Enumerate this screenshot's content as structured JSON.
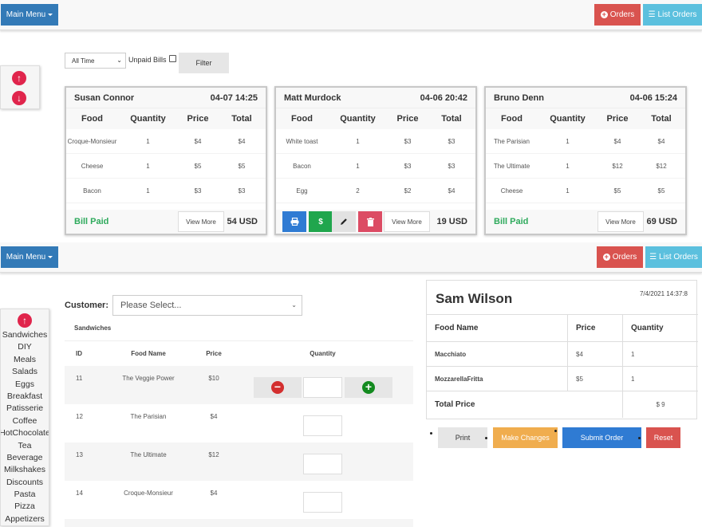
{
  "top_nav": {
    "main_menu": "Main Menu",
    "orders": "Orders",
    "list_orders": "List Orders"
  },
  "filter": {
    "period": "All Time",
    "unpaid_label": "Unpaid Bills",
    "unpaid_checked": false,
    "filter_button": "Filter"
  },
  "orders": [
    {
      "customer": "Susan Connor",
      "datetime": "04-07 14:25",
      "headers": [
        "Food",
        "Quantity",
        "Price",
        "Total"
      ],
      "items": [
        {
          "food": "Croque-Monsieur",
          "qty": "1",
          "price": "$4",
          "total": "$4"
        },
        {
          "food": "Cheese",
          "qty": "1",
          "price": "$5",
          "total": "$5"
        },
        {
          "food": "Bacon",
          "qty": "1",
          "price": "$3",
          "total": "$3"
        }
      ],
      "status": "Bill Paid",
      "view_more": "View More",
      "total": "54 USD"
    },
    {
      "customer": "Matt Murdock",
      "datetime": "04-06 20:42",
      "headers": [
        "Food",
        "Quantity",
        "Price",
        "Total"
      ],
      "items": [
        {
          "food": "White toast",
          "qty": "1",
          "price": "$3",
          "total": "$3"
        },
        {
          "food": "Bacon",
          "qty": "1",
          "price": "$3",
          "total": "$3"
        },
        {
          "food": "Egg",
          "qty": "2",
          "price": "$2",
          "total": "$4"
        }
      ],
      "actions": {
        "print": "print-icon",
        "pay": "$",
        "edit": "pencil-icon",
        "delete": "trash-icon"
      },
      "view_more": "View More",
      "total": "19 USD"
    },
    {
      "customer": "Bruno Denn",
      "datetime": "04-06 15:24",
      "headers": [
        "Food",
        "Quantity",
        "Price",
        "Total"
      ],
      "items": [
        {
          "food": "The Parisian",
          "qty": "1",
          "price": "$4",
          "total": "$4"
        },
        {
          "food": "The Ultimate",
          "qty": "1",
          "price": "$12",
          "total": "$12"
        },
        {
          "food": "Cheese",
          "qty": "1",
          "price": "$5",
          "total": "$5"
        }
      ],
      "status": "Bill Paid",
      "view_more": "View More",
      "total": "69 USD"
    }
  ],
  "bottom_nav": {
    "main_menu": "Main Menu",
    "orders": "Orders",
    "list_orders": "List Orders"
  },
  "order_form": {
    "customer_label": "Customer:",
    "customer_placeholder": "Please Select...",
    "category_title": "Sandwiches",
    "headers": {
      "id": "ID",
      "name": "Food Name",
      "price": "Price",
      "qty": "Quantity"
    },
    "rows": [
      {
        "id": "11",
        "name": "The Veggie Power",
        "price": "$10",
        "qty": ""
      },
      {
        "id": "12",
        "name": "The Parisian",
        "price": "$4",
        "qty": ""
      },
      {
        "id": "13",
        "name": "The Ultimate",
        "price": "$12",
        "qty": ""
      },
      {
        "id": "14",
        "name": "Croque-Monsieur",
        "price": "$4",
        "qty": ""
      }
    ]
  },
  "categories": [
    "Sandwiches",
    "DIY",
    "Meals",
    "Salads",
    "Eggs",
    "Breakfast",
    "Patisserie",
    "Coffee",
    "HotChocolate",
    "Tea",
    "Beverage",
    "Milkshakes",
    "Discounts",
    "Pasta",
    "Pizza",
    "Appetizers"
  ],
  "receipt": {
    "customer": "Sam Wilson",
    "datetime": "7/4/2021 14:37:8",
    "headers": {
      "name": "Food Name",
      "price": "Price",
      "qty": "Quantity"
    },
    "items": [
      {
        "name": "Macchiato",
        "price": "$4",
        "qty": "1"
      },
      {
        "name": "MozzarellaFritta",
        "price": "$5",
        "qty": "1"
      }
    ],
    "total_label": "Total Price",
    "total_value": "$ 9"
  },
  "receipt_actions": {
    "print": "Print",
    "make_changes": "Make Changes",
    "submit": "Submit Order",
    "reset": "Reset"
  },
  "colors": {
    "primary": "#337ab7",
    "danger": "#d9534f",
    "info": "#5bc0de",
    "success": "#2eaa5c",
    "warning": "#f0ad4e",
    "submit": "#2f7bd3"
  }
}
